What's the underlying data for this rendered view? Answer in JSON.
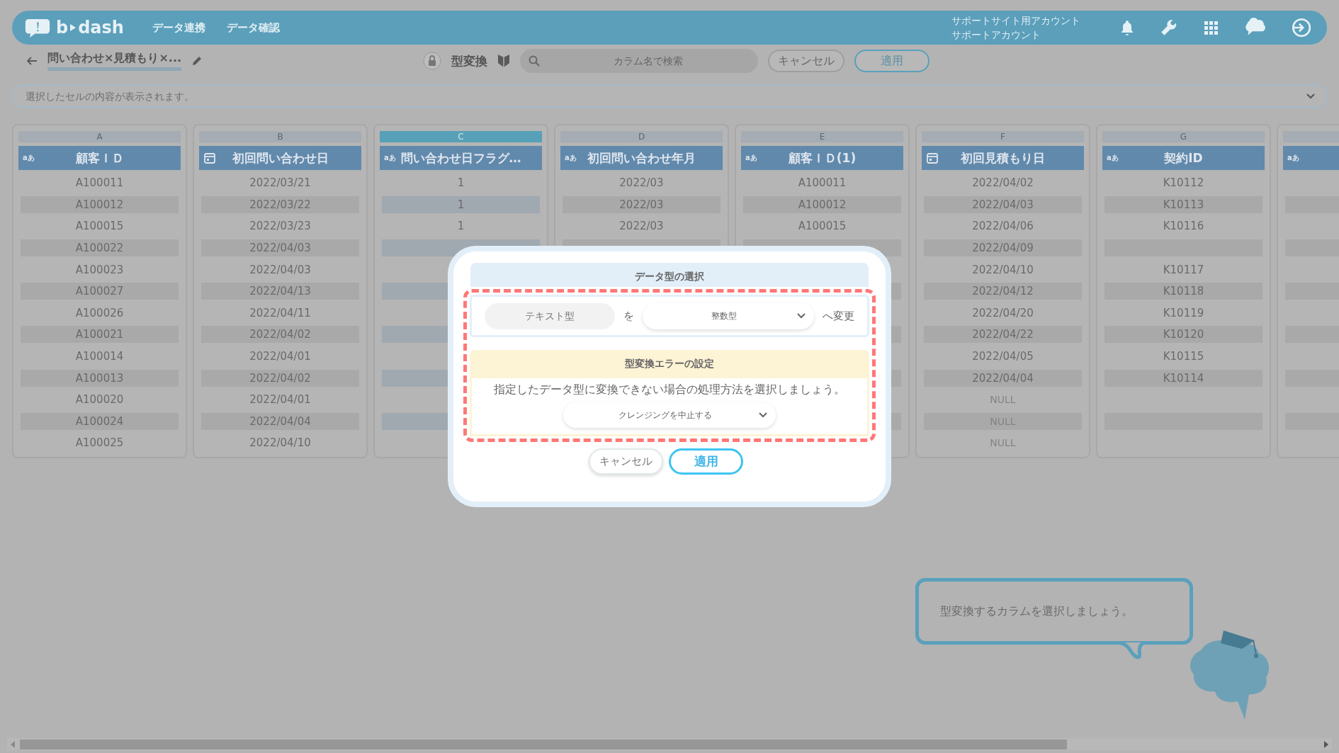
{
  "header": {
    "logo": {
      "left": "b",
      "right": "dash"
    },
    "nav": [
      "データ連携",
      "データ確認"
    ],
    "account": [
      "サポートサイト用アカウント",
      "サポートアカウント"
    ]
  },
  "toolbar": {
    "title": "問い合わせ×見積もり×...",
    "mode": "型変換",
    "search": {
      "placeholder": "カラム名で検索"
    },
    "buttons": [
      "キャンセル",
      "適用"
    ]
  },
  "cell_bar": {
    "placeholder": "選択したセルの内容が表示されます。"
  },
  "columns": [
    {
      "letter": "A",
      "kind": "text",
      "type_label": "aあ",
      "title": "顧客ＩＤ",
      "selected": false,
      "cells": [
        "A100011",
        "A100012",
        "A100015",
        "A100022",
        "A100023",
        "A100027",
        "A100026",
        "A100021",
        "A100014",
        "A100013",
        "A100020",
        "A100024",
        "A100025"
      ]
    },
    {
      "letter": "B",
      "kind": "date",
      "title": "初回問い合わせ日",
      "selected": false,
      "cells": [
        "2022/03/21",
        "2022/03/22",
        "2022/03/23",
        "2022/04/03",
        "2022/04/03",
        "2022/04/13",
        "2022/04/11",
        "2022/04/02",
        "2022/04/01",
        "2022/04/02",
        "2022/04/01",
        "2022/04/04",
        "2022/04/10"
      ]
    },
    {
      "letter": "C",
      "kind": "text",
      "type_label": "aあ",
      "title": "問い合わせ日フラグ…",
      "selected": true,
      "cells": [
        "1",
        "1",
        "1",
        null,
        null,
        null,
        null,
        null,
        null,
        null,
        null,
        null,
        null
      ]
    },
    {
      "letter": "D",
      "kind": "text",
      "type_label": "aあ",
      "title": "初回問い合わせ年月",
      "selected": false,
      "cells": [
        "2022/03",
        "2022/03",
        "2022/03",
        null
      ]
    },
    {
      "letter": "E",
      "kind": "text",
      "type_label": "aあ",
      "title": "顧客ＩＤ(1)",
      "selected": false,
      "cells": [
        "A100011",
        "A100012",
        "A100015",
        null,
        null,
        null,
        null,
        null,
        null,
        null,
        null,
        null,
        null
      ]
    },
    {
      "letter": "F",
      "kind": "date",
      "title": "初回見積もり日",
      "selected": false,
      "cells": [
        "2022/04/02",
        "2022/04/03",
        "2022/04/06",
        "2022/04/09",
        "2022/04/10",
        "2022/04/12",
        "2022/04/20",
        "2022/04/22",
        "2022/04/05",
        "2022/04/04",
        {
          "text": "NULL",
          "muted": true
        },
        {
          "text": "NULL",
          "muted": true
        },
        {
          "text": "NULL",
          "muted": true
        }
      ]
    },
    {
      "letter": "G",
      "kind": "text",
      "type_label": "aあ",
      "title": "契約ID",
      "selected": false,
      "cells": [
        "K10112",
        "K10113",
        "K10116",
        null,
        "K10117",
        "K10118",
        "K10119",
        "K10120",
        "K10115",
        "K10114",
        null,
        null,
        null
      ]
    },
    {
      "kind": "text",
      "type_label": "aあ",
      "selected": false,
      "cells": [
        null,
        null,
        null,
        null,
        null,
        null,
        null,
        null,
        null,
        null,
        null,
        null,
        null
      ]
    }
  ],
  "dialog": {
    "title": "データ型の選択",
    "from_type": "テキスト型",
    "particle": "を",
    "to_type": "整数型",
    "suffix": "へ変更",
    "error_title": "型変換エラーの設定",
    "error_text": "指定したデータ型に変換できない場合の処理方法を選択しましょう。",
    "error_action": "クレンジングを中止する",
    "buttons": [
      "キャンセル",
      "適用"
    ]
  },
  "guide": {
    "message": "型変換するカラムを選択しましょう。"
  }
}
